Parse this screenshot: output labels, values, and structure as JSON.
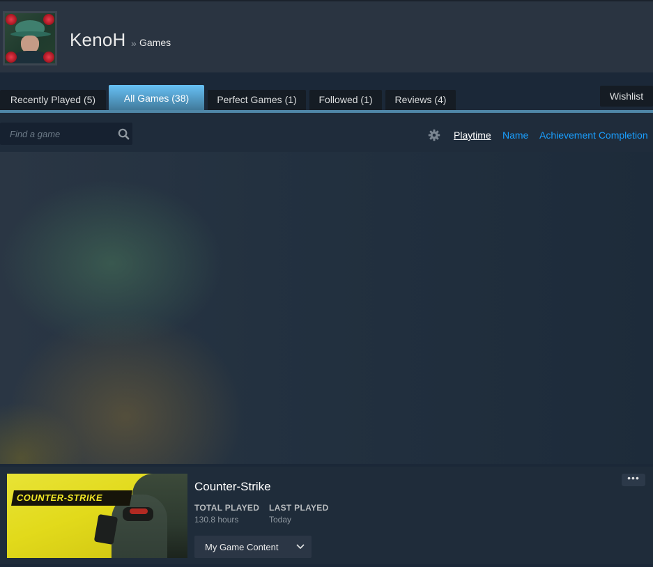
{
  "profile": {
    "name": "KenoH",
    "breadcrumb_separator": "»",
    "breadcrumb_page": "Games"
  },
  "tabs": [
    {
      "label": "Recently Played (5)",
      "active": false
    },
    {
      "label": "All Games (38)",
      "active": true
    },
    {
      "label": "Perfect Games (1)",
      "active": false
    },
    {
      "label": "Followed (1)",
      "active": false
    },
    {
      "label": "Reviews (4)",
      "active": false
    }
  ],
  "wishlist_label": "Wishlist",
  "search": {
    "placeholder": "Find a game",
    "value": ""
  },
  "sort": {
    "options": [
      "Playtime",
      "Name",
      "Achievement Completion"
    ],
    "active": "Playtime"
  },
  "game": {
    "title": "Counter-Strike",
    "capsule_logo_text": "COUNTER-STRIKE",
    "total_played_label": "TOTAL PLAYED",
    "total_played_value": "130.8 hours",
    "last_played_label": "LAST PLAYED",
    "last_played_value": "Today",
    "content_button_label": "My Game Content",
    "more_label": "•••"
  },
  "colors": {
    "background": "#1b2838",
    "header": "#2a3441",
    "tab_active": "#67c1f5",
    "link": "#1a9fff",
    "accent_bar": "#4f87a8"
  }
}
